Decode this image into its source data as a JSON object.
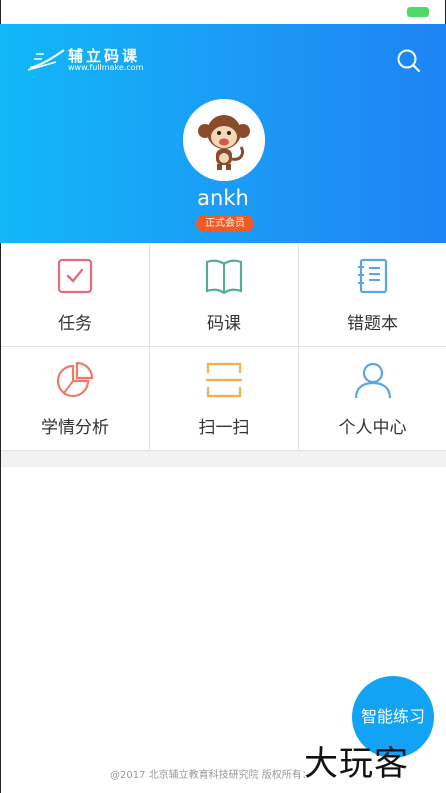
{
  "header": {
    "logo_title": "辅立码课",
    "logo_url": "www.fullmake.com"
  },
  "profile": {
    "username": "ankh",
    "badge": "正式会员"
  },
  "menu": [
    {
      "label": "任务",
      "icon": "task-check-icon",
      "color": "#e36b7a"
    },
    {
      "label": "码课",
      "icon": "book-icon",
      "color": "#4fb08a"
    },
    {
      "label": "错题本",
      "icon": "notebook-icon",
      "color": "#5ba6e0"
    },
    {
      "label": "学情分析",
      "icon": "pie-chart-icon",
      "color": "#ef7a66"
    },
    {
      "label": "扫一扫",
      "icon": "scan-icon",
      "color": "#f2b04c"
    },
    {
      "label": "个人中心",
      "icon": "user-icon",
      "color": "#5ba6e0"
    }
  ],
  "practice_button": "智能练习",
  "footer": "@2017 北京辅立教育科技研究院 版权所有：",
  "watermark": "大玩客",
  "colors": {
    "hero_start": "#11b8f8",
    "hero_end": "#1d84f3",
    "badge": "#f15a22",
    "practice": "#13a3f4"
  }
}
